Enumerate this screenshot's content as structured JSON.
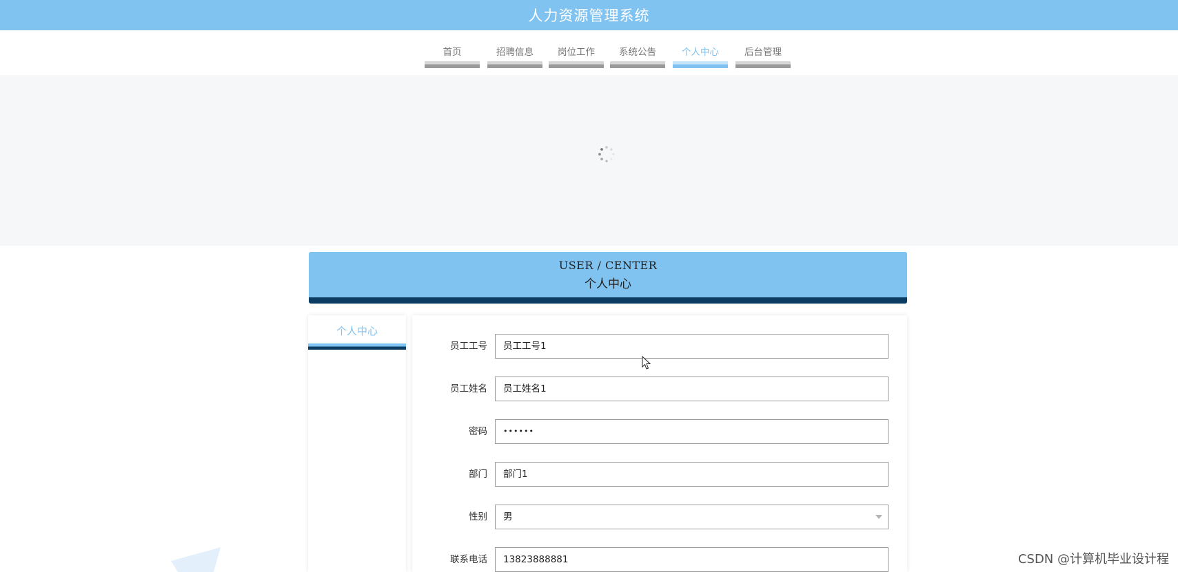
{
  "app": {
    "title": "人力资源管理系统"
  },
  "nav": {
    "items": [
      {
        "label": "首页"
      },
      {
        "label": "招聘信息"
      },
      {
        "label": "岗位工作"
      },
      {
        "label": "系统公告"
      },
      {
        "label": "个人中心",
        "active": true
      },
      {
        "label": "后台管理"
      }
    ]
  },
  "banner": {
    "loading_icon": "spinner-icon"
  },
  "section": {
    "title_en": "USER / CENTER",
    "title_cn": "个人中心"
  },
  "sidebar": {
    "items": [
      {
        "label": "个人中心",
        "active": true
      }
    ]
  },
  "form": {
    "fields": [
      {
        "label": "员工工号",
        "value": "员工工号1",
        "type": "text"
      },
      {
        "label": "员工姓名",
        "value": "员工姓名1",
        "type": "text"
      },
      {
        "label": "密码",
        "value": "••••••",
        "type": "password"
      },
      {
        "label": "部门",
        "value": "部门1",
        "type": "text"
      },
      {
        "label": "性别",
        "value": "男",
        "type": "select"
      },
      {
        "label": "联系电话",
        "value": "13823888881",
        "type": "text"
      }
    ]
  },
  "watermark": {
    "text": "CSDN @计算机毕业设计程"
  },
  "colors": {
    "primary": "#80c3f0",
    "dark_accent": "#0c3c62",
    "banner_bg": "#f6f7f8",
    "nav_inactive_bar": "#9a9a9a"
  }
}
